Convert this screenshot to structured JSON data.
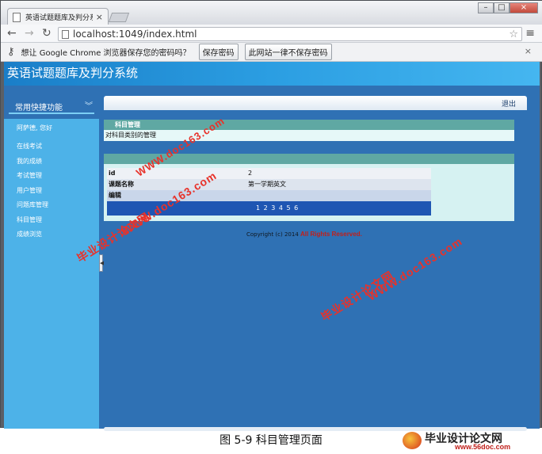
{
  "browser": {
    "tab_title": "英语试题题库及判分系统",
    "tab_close": "×",
    "url": "localhost:1049/index.html",
    "infobar_message": "想让 Google Chrome 浏览器保存您的密码吗？",
    "save_password_label": "保存密码",
    "never_save_label": "此网站一律不保存密码",
    "infobar_close": "×"
  },
  "app": {
    "title": "英语试题题库及判分系统",
    "logout_label": "退出"
  },
  "sidebar": {
    "section_title": "常用快捷功能",
    "greeting": "阿萨德, 您好",
    "items": [
      "在线考试",
      "我的成绩",
      "考试管理",
      "用户管理",
      "问题库管理",
      "科目管理",
      "成绩浏览"
    ]
  },
  "subject_section": {
    "header": "科目管理",
    "description": "对科目类别的管理"
  },
  "detail_table": {
    "rows": [
      {
        "key": "id",
        "value": "2"
      },
      {
        "key": "课题名称",
        "value": "第一学期英文"
      },
      {
        "key": "编辑",
        "value": ""
      }
    ],
    "pager": "1 2 3 4 5 6"
  },
  "footer": {
    "copyright_prefix": "Copyright (c) 2014",
    "copyright_suffix": "All Rights Reserved."
  },
  "watermarks": {
    "cn": "毕业设计论文网",
    "url": "WWW.doc163.com"
  },
  "figure": {
    "caption": "图 5-9  科目管理页面",
    "logo_name": "毕业设计论文网",
    "logo_site": "www.56doc.com"
  },
  "colors": {
    "page_bg": "#2f71b4",
    "sidebar_bg": "#4db2e8",
    "section_header": "#5fa8a3",
    "watermark": "#e8322a"
  }
}
